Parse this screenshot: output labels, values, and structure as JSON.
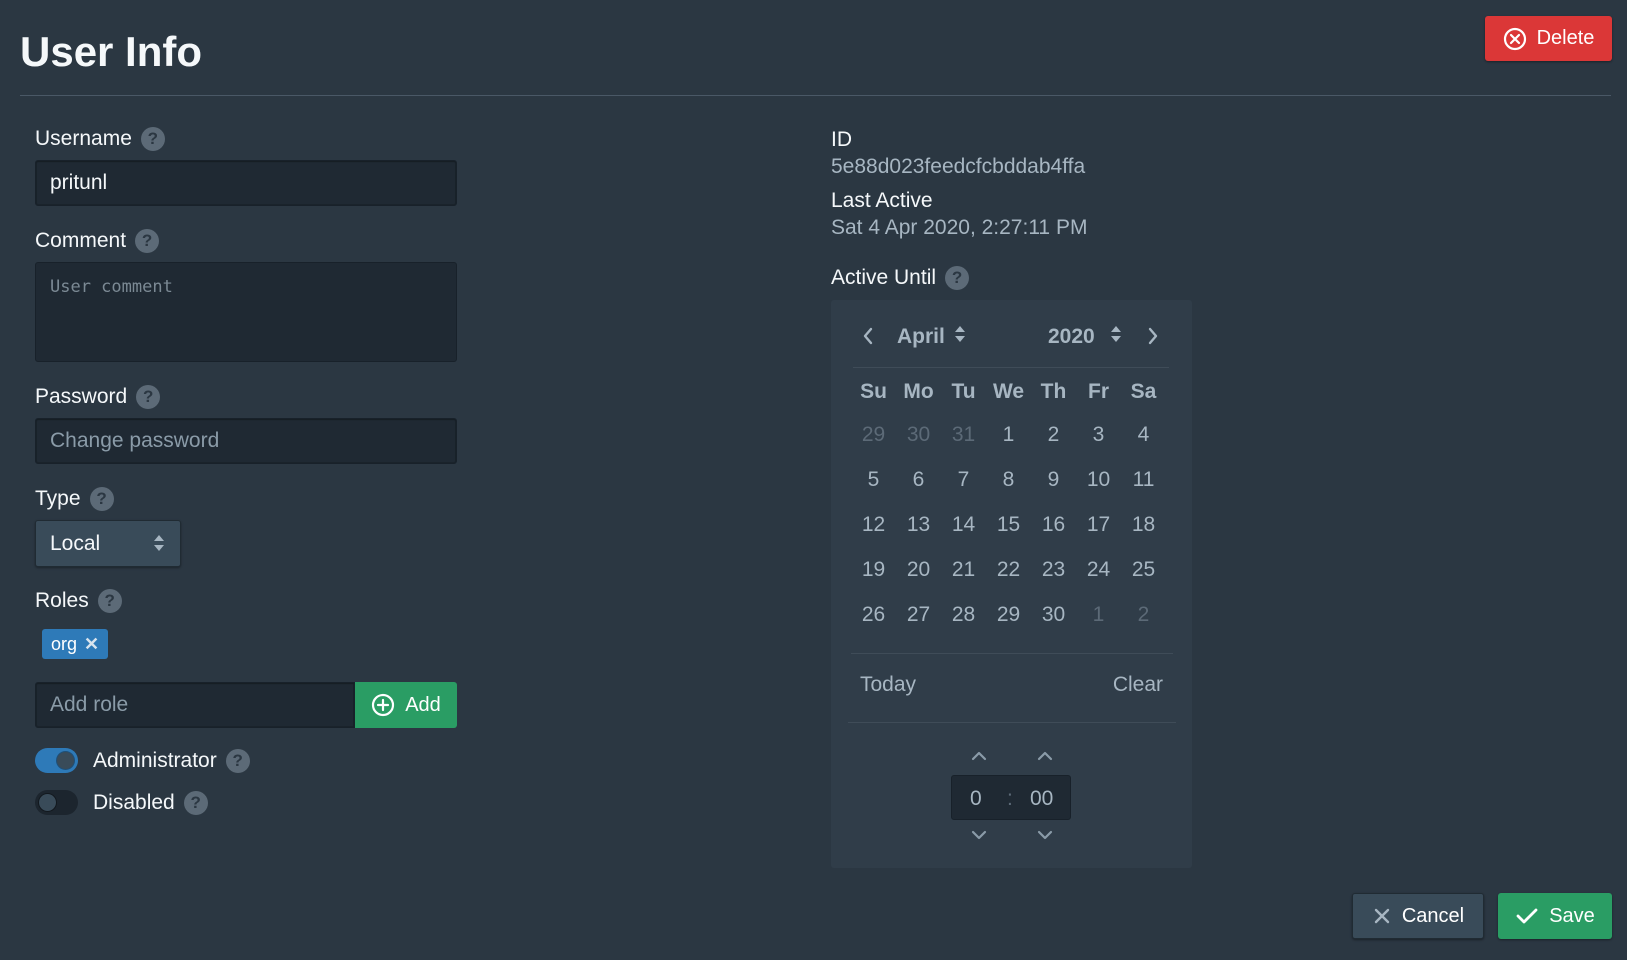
{
  "header": {
    "title": "User Info",
    "delete_label": "Delete"
  },
  "form": {
    "username": {
      "label": "Username",
      "value": "pritunl"
    },
    "comment": {
      "label": "Comment",
      "placeholder": "User comment"
    },
    "password": {
      "label": "Password",
      "placeholder": "Change password"
    },
    "type": {
      "label": "Type",
      "selected": "Local"
    },
    "roles": {
      "label": "Roles",
      "tags": [
        "org"
      ],
      "add_placeholder": "Add role",
      "add_label": "Add"
    },
    "administrator": {
      "label": "Administrator",
      "checked": true
    },
    "disabled": {
      "label": "Disabled",
      "checked": false
    }
  },
  "info": {
    "id_label": "ID",
    "id_value": "5e88d023feedcfcbddab4ffa",
    "last_active_label": "Last Active",
    "last_active_value": "Sat 4 Apr 2020, 2:27:11 PM",
    "active_until_label": "Active Until"
  },
  "calendar": {
    "month": "April",
    "year": "2020",
    "weekdays": [
      "Su",
      "Mo",
      "Tu",
      "We",
      "Th",
      "Fr",
      "Sa"
    ],
    "weeks": [
      [
        "29",
        "30",
        "31",
        "1",
        "2",
        "3",
        "4"
      ],
      [
        "5",
        "6",
        "7",
        "8",
        "9",
        "10",
        "11"
      ],
      [
        "12",
        "13",
        "14",
        "15",
        "16",
        "17",
        "18"
      ],
      [
        "19",
        "20",
        "21",
        "22",
        "23",
        "24",
        "25"
      ],
      [
        "26",
        "27",
        "28",
        "29",
        "30",
        "1",
        "2"
      ]
    ],
    "today_label": "Today",
    "clear_label": "Clear",
    "hour": "0",
    "separator": ":",
    "minute": "00"
  },
  "footer": {
    "cancel_label": "Cancel",
    "save_label": "Save"
  },
  "colors": {
    "background": "#2b3742",
    "danger": "#db3737",
    "success": "#2a9d64",
    "primary": "#2e7ab8"
  },
  "icons": {
    "delete": "circle-x-icon",
    "add": "circle-plus-icon",
    "cancel": "x-icon",
    "save": "check-icon",
    "help": "help-icon"
  }
}
